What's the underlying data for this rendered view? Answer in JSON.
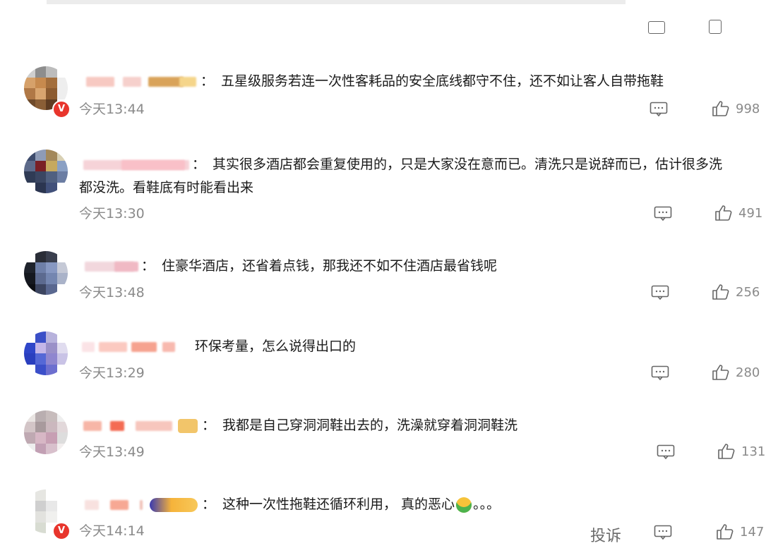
{
  "comments": [
    {
      "id": "c1",
      "text": "五星级服务若连一次性客耗品的安全底线都守不住，还不如让客人自带拖鞋",
      "time": "今天13:44",
      "likes": "998",
      "verified": true,
      "medal": true
    },
    {
      "id": "c2",
      "text": "其实很多酒店都会重复使用的，只是大家没在意而已。清洗只是说辞而已，估计很多洗",
      "text2": "都没洗。看鞋底有时能看出来",
      "time": "今天13:30",
      "likes": "491",
      "verified": false,
      "medal": false
    },
    {
      "id": "c3",
      "text": "住豪华酒店，还省着点钱，那我还不如不住酒店最省钱呢",
      "time": "今天13:48",
      "likes": "256",
      "verified": false,
      "medal": false
    },
    {
      "id": "c4",
      "text": "环保考量，怎么说得出口的",
      "time": "今天13:29",
      "likes": "280",
      "verified": false,
      "medal": false
    },
    {
      "id": "c5",
      "text": "我都是自己穿洞洞鞋出去的，洗澡就穿着洞洞鞋洗",
      "time": "今天13:49",
      "likes": "131",
      "verified": false,
      "medal": true
    },
    {
      "id": "c6",
      "text": "这种一次性拖鞋还循环利用，  真的恶心",
      "text_tail": "。。。",
      "time": "今天14:14",
      "likes": "147",
      "verified": true,
      "medal": true,
      "report_label": "投诉"
    }
  ],
  "colon": "："
}
